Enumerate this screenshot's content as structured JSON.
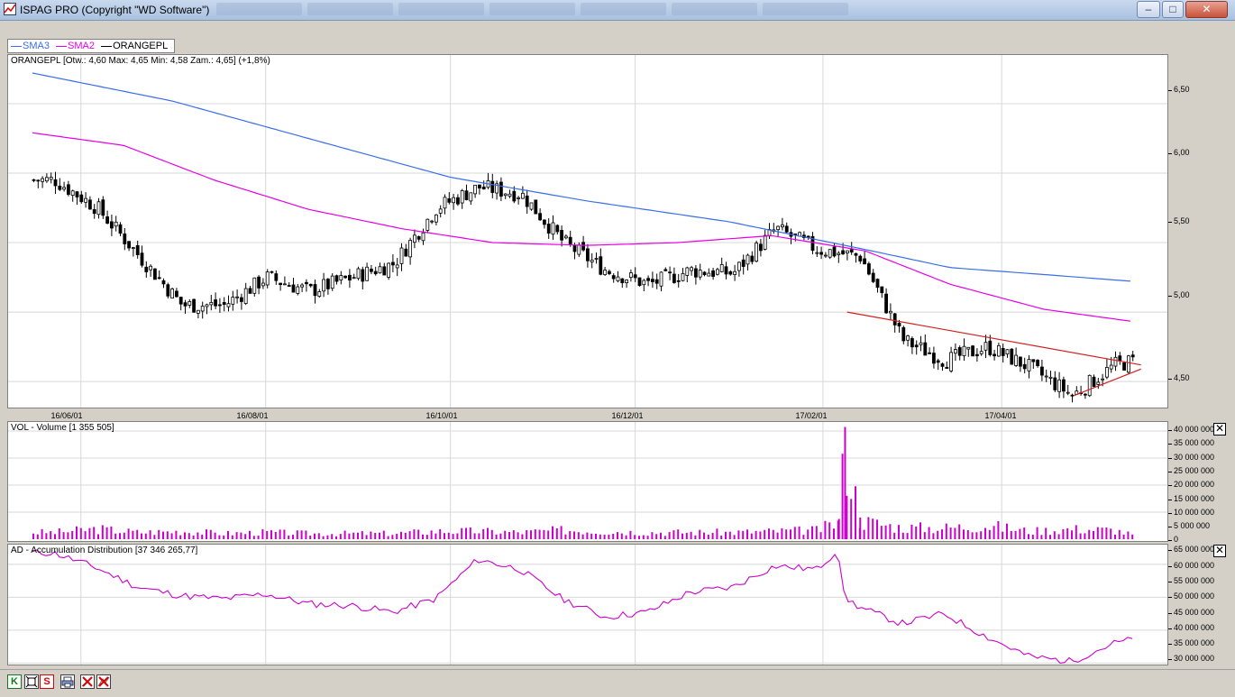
{
  "window": {
    "title": "ISPAG PRO (Copyright \"WD Software\")",
    "minimize": "–",
    "maximize": "□",
    "close": "✕"
  },
  "legend": {
    "sma3": "SMA3",
    "sma2": "SMA2",
    "instrument": "ORANGEPL",
    "colors": {
      "sma3": "#3a6ee8",
      "sma2": "#e600e6",
      "instrument": "#000000"
    }
  },
  "price_panel": {
    "label": "ORANGEPL [Otw.: 4,60  Max: 4,65  Min: 4,58  Zam.: 4,65] (+1,8%)",
    "y_ticks": [
      "6,50",
      "6,00",
      "5,50",
      "5,00",
      "4,50"
    ]
  },
  "x_axis": {
    "labels": [
      "16/06/01",
      "16/08/01",
      "16/10/01",
      "16/12/01",
      "17/02/01",
      "17/04/01"
    ]
  },
  "volume_panel": {
    "label": "VOL - Volume [1 355 505]",
    "y_ticks": [
      "40 000 000",
      "35 000 000",
      "30 000 000",
      "25 000 000",
      "20 000 000",
      "15 000 000",
      "10 000 000",
      "5 000 000",
      "0"
    ],
    "close_icon": "✕"
  },
  "ad_panel": {
    "label": "AD - Accumulation Distribution [37 346 265,77]",
    "y_ticks": [
      "65 000 000",
      "60 000 000",
      "55 000 000",
      "50 000 000",
      "45 000 000",
      "40 000 000",
      "35 000 000",
      "30 000 000"
    ],
    "close_icon": "✕"
  },
  "toolbar": {
    "k": "K",
    "s": "S"
  },
  "chart_data": [
    {
      "type": "candlestick",
      "title": "ORANGEPL",
      "x_labels": [
        "16/06/01",
        "16/08/01",
        "16/10/01",
        "16/12/01",
        "17/02/01",
        "17/04/01"
      ],
      "x_range": [
        "2016-05-16",
        "2017-05-15"
      ],
      "ylim": [
        4.3,
        6.85
      ],
      "grid": true,
      "series": [
        {
          "name": "ORANGEPL",
          "color": "#000000",
          "x": [
            "2016-05-23",
            "2016-06-06",
            "2016-06-20",
            "2016-07-04",
            "2016-07-18",
            "2016-08-01",
            "2016-08-15",
            "2016-08-29",
            "2016-09-12",
            "2016-09-26",
            "2016-10-10",
            "2016-10-24",
            "2016-11-07",
            "2016-11-21",
            "2016-12-05",
            "2016-12-19",
            "2017-01-02",
            "2017-01-16",
            "2017-01-30",
            "2017-02-13",
            "2017-02-27",
            "2017-03-13",
            "2017-03-27",
            "2017-04-10",
            "2017-04-24",
            "2017-05-08",
            "2017-05-15"
          ],
          "close": [
            5.95,
            5.75,
            5.4,
            5.05,
            5.05,
            5.25,
            5.15,
            5.25,
            5.35,
            5.75,
            5.9,
            5.85,
            5.5,
            5.3,
            5.2,
            5.3,
            5.28,
            5.6,
            5.45,
            5.4,
            4.8,
            4.65,
            4.75,
            4.6,
            4.4,
            4.62,
            4.65
          ]
        },
        {
          "name": "SMA3",
          "color": "#3a6ee8",
          "x": [
            "2016-05-16",
            "2016-07-01",
            "2016-08-15",
            "2016-10-01",
            "2016-11-15",
            "2017-01-01",
            "2017-02-15",
            "2017-03-15",
            "2017-04-15",
            "2017-05-15"
          ],
          "y": [
            6.72,
            6.52,
            6.25,
            5.97,
            5.8,
            5.65,
            5.45,
            5.32,
            5.27,
            5.22
          ]
        },
        {
          "name": "SMA2",
          "color": "#e600e6",
          "x": [
            "2016-05-16",
            "2016-06-15",
            "2016-07-15",
            "2016-08-15",
            "2016-09-15",
            "2016-10-15",
            "2016-11-15",
            "2016-12-15",
            "2017-01-15",
            "2017-02-15",
            "2017-03-15",
            "2017-04-15",
            "2017-05-15"
          ],
          "y": [
            6.29,
            6.2,
            5.95,
            5.74,
            5.6,
            5.5,
            5.48,
            5.5,
            5.55,
            5.44,
            5.2,
            5.02,
            4.93
          ]
        }
      ],
      "annotations": [
        {
          "name": "resistance-line",
          "color": "#d22020",
          "x": [
            "2017-02-09",
            "2017-05-17"
          ],
          "y": [
            5.0,
            4.62
          ]
        },
        {
          "name": "support-line",
          "color": "#d22020",
          "x": [
            "2017-04-25",
            "2017-05-17"
          ],
          "y": [
            4.4,
            4.59
          ]
        }
      ]
    },
    {
      "type": "bar",
      "title": "VOL - Volume",
      "ylim": [
        0,
        42000000
      ],
      "color": "#cc00cc",
      "x": [
        "2016-05-23",
        "2016-06-06",
        "2016-06-20",
        "2016-07-04",
        "2016-07-18",
        "2016-08-01",
        "2016-08-15",
        "2016-08-29",
        "2016-09-12",
        "2016-09-26",
        "2016-10-10",
        "2016-10-24",
        "2016-11-07",
        "2016-11-21",
        "2016-12-05",
        "2016-12-19",
        "2017-01-02",
        "2017-01-16",
        "2017-01-30",
        "2017-02-06",
        "2017-02-08",
        "2017-02-13",
        "2017-02-27",
        "2017-03-13",
        "2017-03-27",
        "2017-04-10",
        "2017-04-24",
        "2017-05-08",
        "2017-05-15"
      ],
      "values": [
        3000000,
        4500000,
        3000000,
        3500000,
        2500000,
        3000000,
        2500000,
        2500000,
        2500000,
        3500000,
        3500000,
        3000000,
        4000000,
        3500000,
        3000000,
        3000000,
        3000000,
        3500000,
        4000000,
        7500000,
        41500000,
        8000000,
        5000000,
        5000000,
        6000000,
        3500000,
        4500000,
        4000000,
        1500000
      ]
    },
    {
      "type": "line",
      "title": "AD - Accumulation Distribution",
      "ylim": [
        29000000,
        66000000
      ],
      "color": "#cc00cc",
      "x": [
        "2016-05-23",
        "2016-06-06",
        "2016-06-20",
        "2016-07-04",
        "2016-07-18",
        "2016-08-01",
        "2016-08-15",
        "2016-08-29",
        "2016-09-12",
        "2016-09-26",
        "2016-10-10",
        "2016-10-24",
        "2016-11-07",
        "2016-11-21",
        "2016-12-05",
        "2016-12-19",
        "2017-01-02",
        "2017-01-16",
        "2017-01-30",
        "2017-02-06",
        "2017-02-08",
        "2017-02-13",
        "2017-02-27",
        "2017-03-13",
        "2017-03-27",
        "2017-04-10",
        "2017-04-24",
        "2017-05-08",
        "2017-05-15"
      ],
      "values": [
        63500000,
        59000000,
        53000000,
        50500000,
        49500000,
        51000000,
        48000000,
        47500000,
        45500000,
        49500000,
        61500000,
        58500000,
        49500000,
        44000000,
        45500000,
        51500000,
        53000000,
        59500000,
        58500000,
        64500000,
        50000000,
        47000000,
        42000000,
        45000000,
        38000000,
        32000000,
        30500000,
        36000000,
        37300000
      ]
    }
  ]
}
